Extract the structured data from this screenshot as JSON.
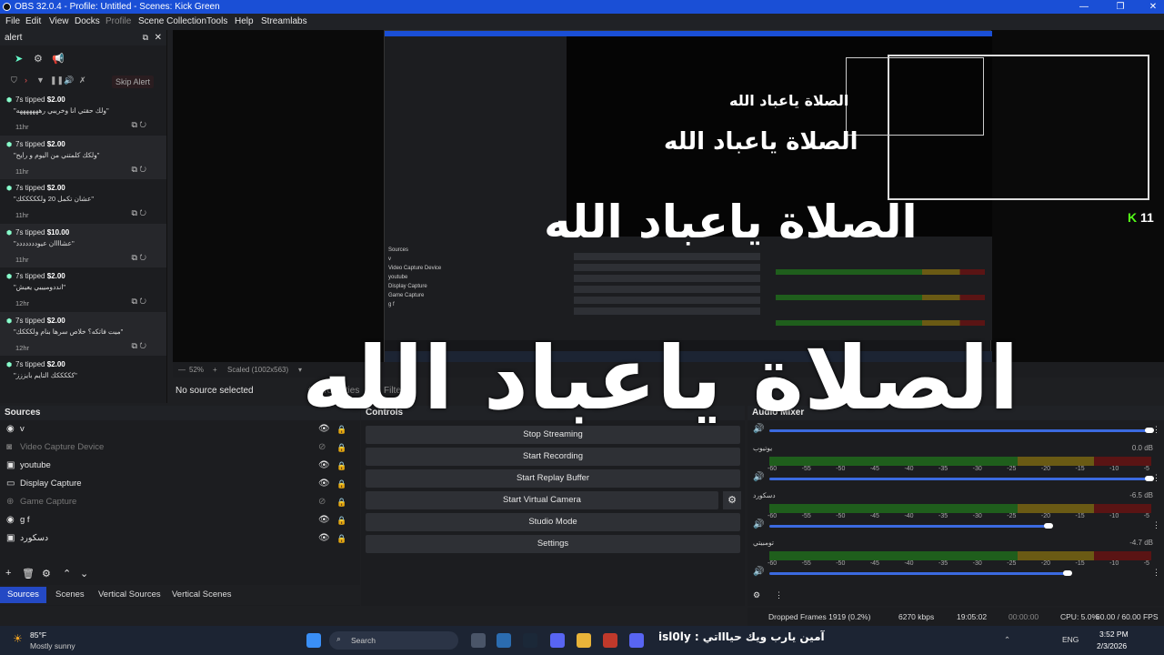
{
  "window": {
    "title": "OBS 32.0.4 - Profile: Untitled - Scenes: Kick Green"
  },
  "menu": [
    "File",
    "Edit",
    "View",
    "Docks",
    "Profile",
    "Scene Collection",
    "Tools",
    "Help",
    "Streamlabs"
  ],
  "alert_dock": {
    "title": "alert",
    "skip_label": "Skip Alert",
    "tips": [
      {
        "who": "7s tipped",
        "amount": "$2.00",
        "msg": "\"ولك حقتي انا وخريبي رهههههههه\"",
        "time": "11hr"
      },
      {
        "who": "7s tipped",
        "amount": "$2.00",
        "msg": "\"ولكك كلمتني من اليوم و رايح\"",
        "time": "11hr"
      },
      {
        "who": "7s tipped",
        "amount": "$2.00",
        "msg": "\"عشان تكمل 20 ولكككككك\"",
        "time": "11hr"
      },
      {
        "who": "7s tipped",
        "amount": "$10.00",
        "msg": "\"عشاااان عيوددددددد\"",
        "time": "11hr"
      },
      {
        "who": "7s tipped",
        "amount": "$2.00",
        "msg": "\"انددوميييي يعيش\"",
        "time": "12hr"
      },
      {
        "who": "7s tipped",
        "amount": "$2.00",
        "msg": "\"ميت فاتكه؟ خلاص سرها بنام ولكككك\"",
        "time": "12hr"
      },
      {
        "who": "7s tipped",
        "amount": "$2.00",
        "msg": "\"كككككك التايم بايززز\"",
        "time": ""
      }
    ]
  },
  "preview": {
    "zoom": "52%",
    "scaled": "Scaled (1002x563)",
    "overlay_text": "الصلاة ياعباد الله",
    "kick_count": "11"
  },
  "selection": {
    "no_source": "No source selected",
    "properties": "Properties",
    "filters": "Filters"
  },
  "sources": {
    "title": "Sources",
    "items": [
      {
        "name": "v",
        "icon": "globe-icon",
        "dim": false
      },
      {
        "name": "Video Capture Device",
        "icon": "camera-icon",
        "dim": true
      },
      {
        "name": "youtube",
        "icon": "window-icon",
        "dim": false
      },
      {
        "name": "Display Capture",
        "icon": "monitor-icon",
        "dim": false
      },
      {
        "name": "Game Capture",
        "icon": "gamepad-icon",
        "dim": true
      },
      {
        "name": "g f",
        "icon": "globe-icon",
        "dim": false
      },
      {
        "name": "دسكورد",
        "icon": "window-icon",
        "dim": false
      }
    ]
  },
  "bottom_tabs": [
    "Sources",
    "Scenes",
    "Vertical Sources",
    "Vertical Scenes"
  ],
  "controls": {
    "title": "Controls",
    "buttons": [
      "Stop Streaming",
      "Start Recording",
      "Start Replay Buffer",
      "Start Virtual Camera",
      "Studio Mode",
      "Settings"
    ]
  },
  "mixer": {
    "title": "Audio Mixer",
    "channels": [
      {
        "name": "",
        "db": "",
        "level": 0.995
      },
      {
        "name": "يوتيوب",
        "db": "0.0 dB",
        "level": 0.995
      },
      {
        "name": "دسكورد",
        "db": "-6.5 dB",
        "level": 0.73
      },
      {
        "name": "تومبيتي",
        "db": "-4.7 dB",
        "level": 0.78
      }
    ],
    "scale": [
      "-60",
      "-55",
      "-50",
      "-45",
      "-40",
      "-35",
      "-30",
      "-25",
      "-20",
      "-15",
      "-10",
      "-5"
    ]
  },
  "status": {
    "dropped": "Dropped Frames 1919 (0.2%)",
    "kbps": "6270 kbps",
    "stream_time": "19:05:02",
    "rec_time": "00:00:00",
    "cpu": "CPU: 5.0%",
    "fps": "60.00 / 60.00 FPS"
  },
  "taskbar": {
    "weather_temp": "85°F",
    "weather_desc": "Mostly sunny",
    "search": "Search",
    "marquee": "آمين يارب ويك حياااتي : isl0ly",
    "lang": "ENG",
    "time": "3:52 PM",
    "date": "2/3/2026"
  },
  "colors": {
    "accent": "#2449c4",
    "titlebar": "#1a4fd6",
    "kick_green": "#53fc18"
  }
}
